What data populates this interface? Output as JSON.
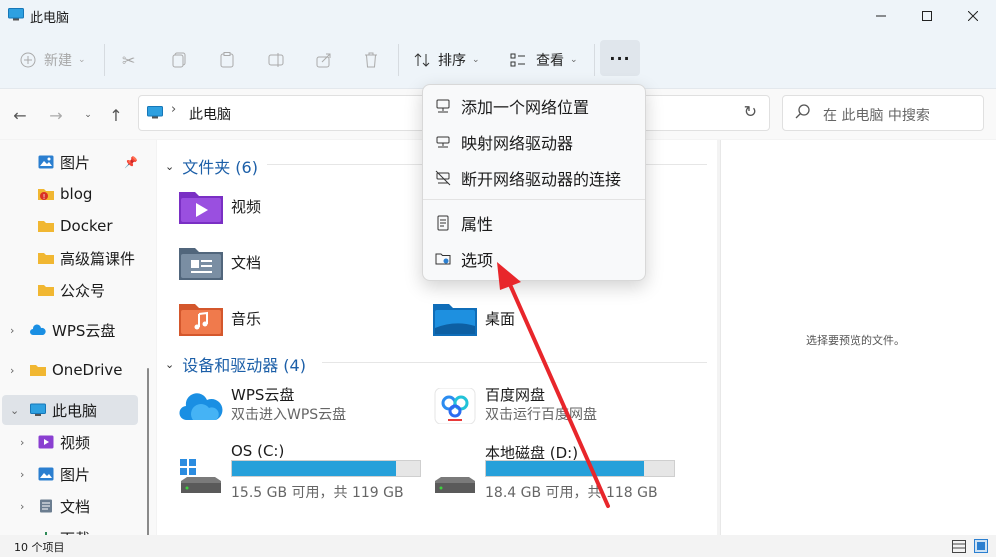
{
  "window": {
    "title": "此电脑"
  },
  "toolbar": {
    "new_label": "新建",
    "sort_label": "排序",
    "view_label": "查看",
    "more_label": "···"
  },
  "address": {
    "crumb": "此电脑",
    "search_placeholder": "在 此电脑 中搜索"
  },
  "sidebar": {
    "items": [
      {
        "label": "图片"
      },
      {
        "label": "blog"
      },
      {
        "label": "Docker"
      },
      {
        "label": "高级篇课件"
      },
      {
        "label": "公众号"
      },
      {
        "label": "WPS云盘"
      },
      {
        "label": "OneDrive"
      },
      {
        "label": "此电脑"
      },
      {
        "label": "视频"
      },
      {
        "label": "图片"
      },
      {
        "label": "文档"
      },
      {
        "label": "下载"
      }
    ]
  },
  "main": {
    "folders_header": "文件夹 (6)",
    "folders": [
      {
        "name": "视频"
      },
      {
        "name": "文档"
      },
      {
        "name": "音乐"
      },
      {
        "name": "桌面"
      }
    ],
    "devices_header": "设备和驱动器 (4)",
    "devices": [
      {
        "name": "WPS云盘",
        "sub": "双击进入WPS云盘"
      },
      {
        "name": "百度网盘",
        "sub": "双击运行百度网盘"
      }
    ],
    "drives": [
      {
        "name": "OS (C:)",
        "usage": "15.5 GB 可用，共 119 GB",
        "used_fraction": 0.87
      },
      {
        "name": "本地磁盘 (D:)",
        "usage": "18.4 GB 可用，共 118 GB",
        "used_fraction": 0.84
      }
    ]
  },
  "preview": {
    "message": "选择要预览的文件。"
  },
  "status": {
    "count": "10 个项目"
  },
  "menu": {
    "items": [
      {
        "label": "添加一个网络位置"
      },
      {
        "label": "映射网络驱动器"
      },
      {
        "label": "断开网络驱动器的连接"
      },
      {
        "label": "属性"
      },
      {
        "label": "选项"
      }
    ]
  },
  "colors": {
    "accent": "#26a0da",
    "header_blue": "#1c5fa8",
    "arrow_red": "#e8262b"
  }
}
